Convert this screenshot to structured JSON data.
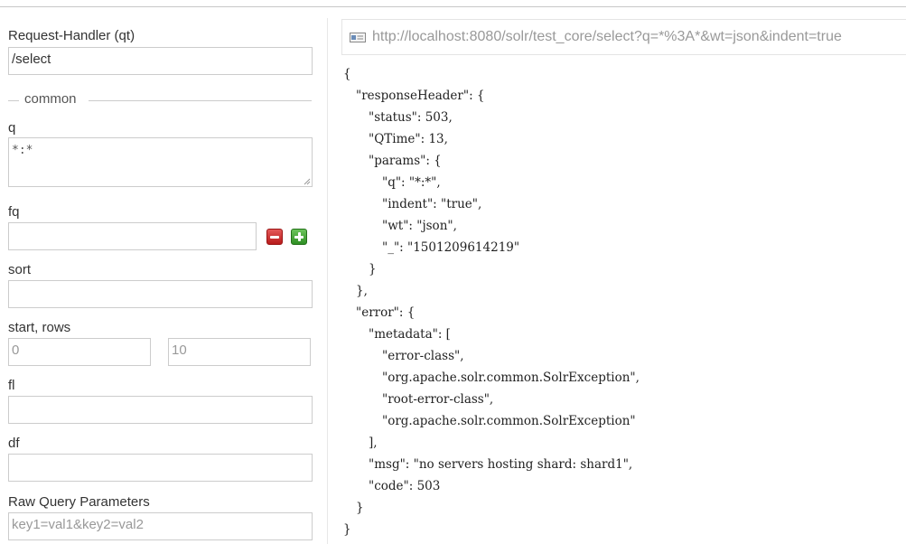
{
  "form": {
    "request_handler": {
      "label": "Request-Handler (qt)",
      "value": "/select"
    },
    "common_legend": "common",
    "q": {
      "label": "q",
      "value": "*:*"
    },
    "fq": {
      "label": "fq",
      "value": ""
    },
    "sort": {
      "label": "sort",
      "value": ""
    },
    "start_rows": {
      "label": "start, rows",
      "start_placeholder": "0",
      "rows_placeholder": "10"
    },
    "fl": {
      "label": "fl",
      "value": ""
    },
    "df": {
      "label": "df",
      "value": ""
    },
    "raw_params": {
      "label": "Raw Query Parameters",
      "placeholder": "key1=val1&key2=val2"
    }
  },
  "result": {
    "url": "http://localhost:8080/solr/test_core/select?q=*%3A*&wt=json&indent=true",
    "json_lines": [
      "{",
      "\"responseHeader\": {",
      "\"status\": 503,",
      "\"QTime\": 13,",
      "\"params\": {",
      "\"q\": \"*:*\",",
      "\"indent\": \"true\",",
      "\"wt\": \"json\",",
      "\"_\": \"1501209614219\"",
      "}",
      "},",
      "\"error\": {",
      "\"metadata\": [",
      "\"error-class\",",
      "\"org.apache.solr.common.SolrException\",",
      "\"root-error-class\",",
      "\"org.apache.solr.common.SolrException\"",
      "],",
      "\"msg\": \"no servers hosting shard: shard1\",",
      "\"code\": 503",
      "}",
      "}"
    ]
  },
  "icons": {
    "remove": "minus-icon",
    "add": "plus-icon",
    "url": "url-document-icon"
  },
  "colors": {
    "remove_button": "#cc2f2f",
    "add_button": "#3ca52f",
    "url_text": "#999999"
  }
}
